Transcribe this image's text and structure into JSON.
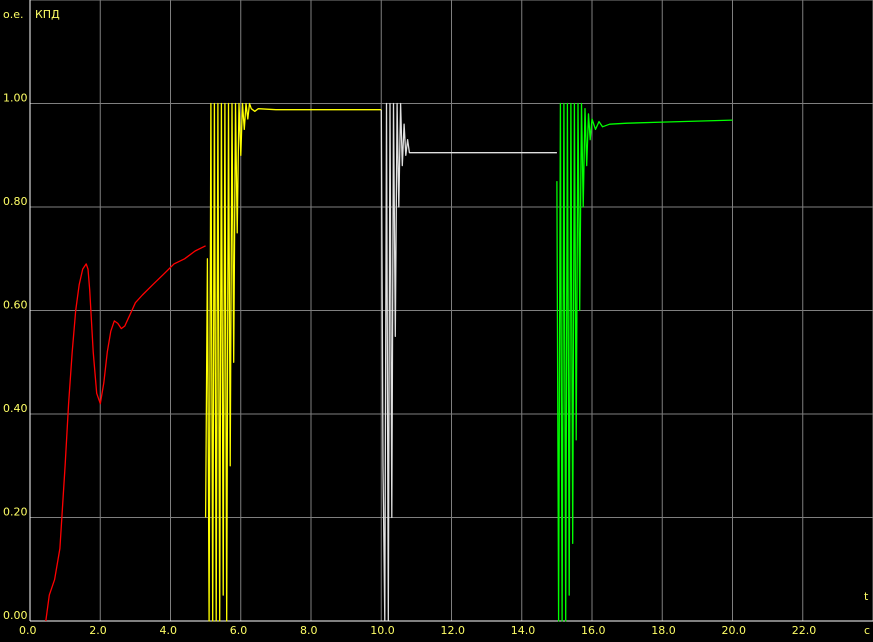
{
  "chart_data": {
    "type": "line",
    "ylabel_unit": "о.е.",
    "title": "КПД",
    "xlabel": "t",
    "xunit": "с",
    "xlim": [
      0,
      24
    ],
    "ylim": [
      0,
      1.2
    ],
    "x_ticks": [
      0,
      2,
      4,
      6,
      8,
      10,
      12,
      14,
      16,
      18,
      20,
      22
    ],
    "x_tick_labels": [
      "0.0",
      "2.0",
      "4.0",
      "6.0",
      "8.0",
      "10.0",
      "12.0",
      "14.0",
      "16.0",
      "18.0",
      "20.0",
      "22.0"
    ],
    "y_ticks": [
      0,
      0.2,
      0.4,
      0.6,
      0.8,
      1.0
    ],
    "y_tick_labels": [
      "0.00",
      "0.20",
      "0.40",
      "0.60",
      "0.80",
      "1.00"
    ],
    "grid": true,
    "colors": {
      "background": "#000000",
      "grid": "#7f7f7f",
      "axis": "#ffffff",
      "labels": "#ffff66"
    },
    "series": [
      {
        "color": "#ff0000",
        "x": [
          0.45,
          0.55,
          0.7,
          0.85,
          1.0,
          1.1,
          1.2,
          1.3,
          1.4,
          1.5,
          1.6,
          1.65,
          1.7,
          1.8,
          1.9,
          2.0,
          2.1,
          2.2,
          2.3,
          2.4,
          2.5,
          2.6,
          2.7,
          2.8,
          2.9,
          3.0,
          3.2,
          3.5,
          3.8,
          4.1,
          4.4,
          4.7,
          5.0
        ],
        "y": [
          0.0,
          0.05,
          0.08,
          0.14,
          0.3,
          0.42,
          0.52,
          0.6,
          0.65,
          0.68,
          0.69,
          0.68,
          0.64,
          0.52,
          0.44,
          0.42,
          0.46,
          0.52,
          0.56,
          0.58,
          0.575,
          0.565,
          0.57,
          0.585,
          0.6,
          0.615,
          0.63,
          0.65,
          0.67,
          0.69,
          0.7,
          0.715,
          0.725
        ]
      },
      {
        "color": "#ffff00",
        "x": [
          5.0,
          5.05,
          5.1,
          5.15,
          5.2,
          5.25,
          5.3,
          5.35,
          5.4,
          5.45,
          5.5,
          5.55,
          5.6,
          5.65,
          5.7,
          5.75,
          5.8,
          5.85,
          5.9,
          5.95,
          6.0,
          6.05,
          6.1,
          6.15,
          6.2,
          6.25,
          6.3,
          6.4,
          6.5,
          7.0,
          8.0,
          9.0,
          10.0
        ],
        "y": [
          0.2,
          0.7,
          0.0,
          1.0,
          0.0,
          1.0,
          0.0,
          1.0,
          0.0,
          1.0,
          0.05,
          1.0,
          0.0,
          1.0,
          0.3,
          1.0,
          0.5,
          1.0,
          0.75,
          1.0,
          0.9,
          1.0,
          0.95,
          1.0,
          0.97,
          1.0,
          0.99,
          0.985,
          0.99,
          0.988,
          0.988,
          0.988,
          0.988
        ]
      },
      {
        "color": "#e0e0e0",
        "x": [
          10.0,
          10.05,
          10.1,
          10.15,
          10.2,
          10.25,
          10.3,
          10.35,
          10.4,
          10.45,
          10.5,
          10.55,
          10.6,
          10.65,
          10.7,
          10.75,
          10.8,
          11.0,
          12.0,
          13.0,
          14.0,
          15.0
        ],
        "y": [
          0.988,
          0.3,
          0.0,
          1.0,
          0.0,
          1.0,
          0.2,
          1.0,
          0.55,
          1.0,
          0.8,
          1.0,
          0.88,
          0.96,
          0.9,
          0.93,
          0.905,
          0.905,
          0.905,
          0.905,
          0.905,
          0.905
        ]
      },
      {
        "color": "#00ff00",
        "x": [
          15.0,
          15.05,
          15.1,
          15.15,
          15.2,
          15.25,
          15.3,
          15.35,
          15.4,
          15.45,
          15.5,
          15.55,
          15.6,
          15.65,
          15.7,
          15.75,
          15.8,
          15.85,
          15.9,
          15.95,
          16.0,
          16.1,
          16.2,
          16.3,
          16.5,
          17.0,
          18.0,
          19.0,
          20.0
        ],
        "y": [
          0.85,
          0.0,
          1.0,
          0.0,
          1.0,
          0.0,
          1.0,
          0.05,
          1.0,
          0.15,
          1.0,
          0.35,
          1.0,
          0.6,
          1.0,
          0.8,
          0.99,
          0.88,
          0.98,
          0.93,
          0.97,
          0.95,
          0.965,
          0.955,
          0.96,
          0.962,
          0.964,
          0.966,
          0.968
        ]
      }
    ]
  }
}
